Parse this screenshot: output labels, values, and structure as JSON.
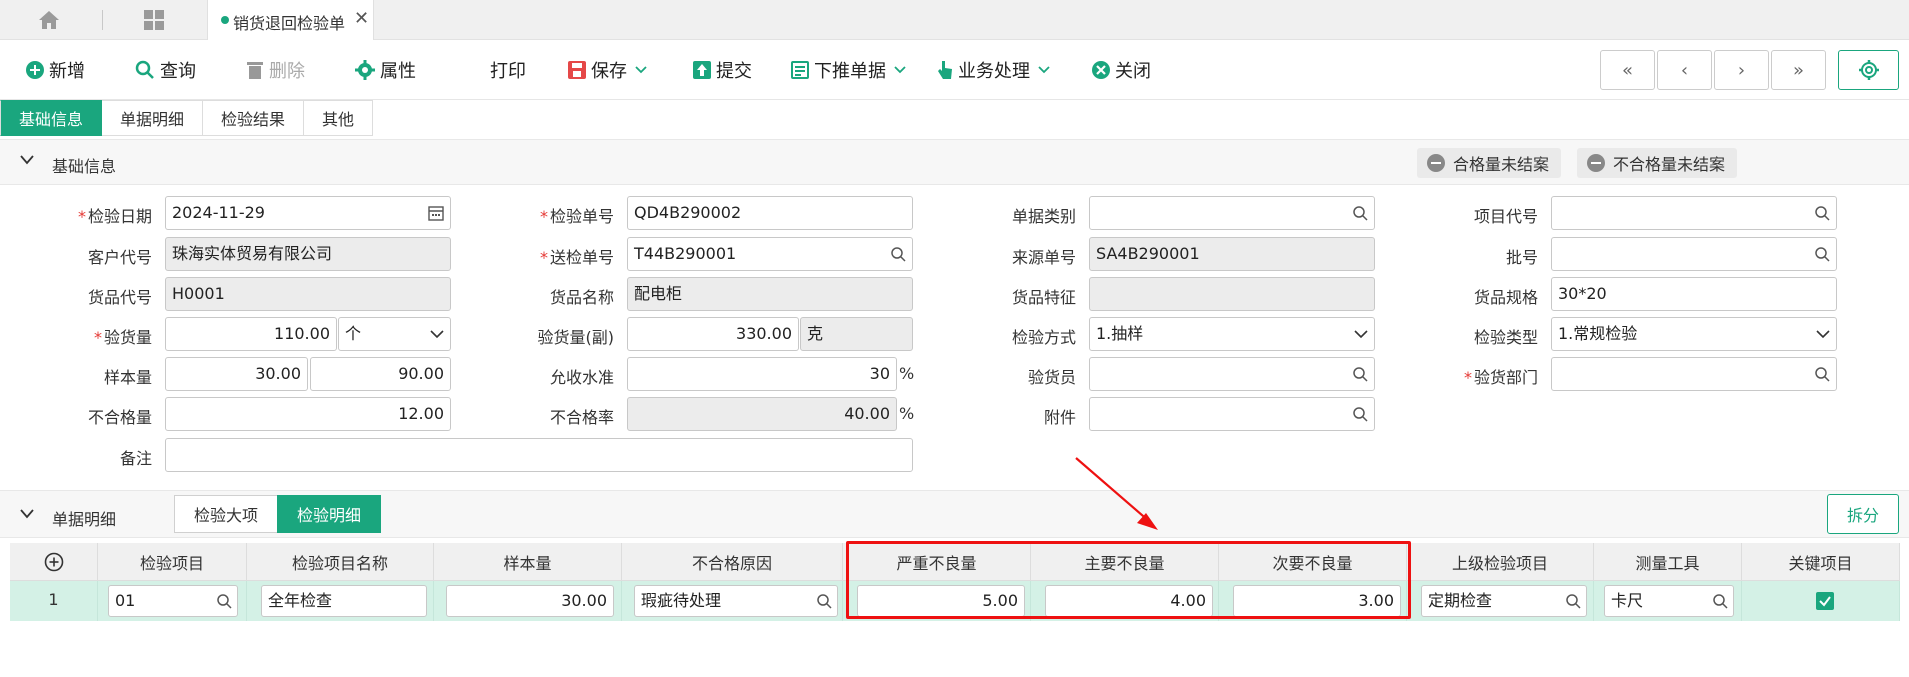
{
  "topbar": {
    "doc_tab_label": "销货退回检验单"
  },
  "toolbar": {
    "add": "新增",
    "query": "查询",
    "delete": "删除",
    "properties": "属性",
    "print": "打印",
    "save": "保存",
    "submit": "提交",
    "push_down": "下推单据",
    "business": "业务处理",
    "close": "关闭"
  },
  "section_tabs": [
    "基础信息",
    "单据明细",
    "检验结果",
    "其他"
  ],
  "basic_group": {
    "title": "基础信息",
    "btn_pass_open": "合格量未结案",
    "btn_fail_open": "不合格量未结案"
  },
  "form": {
    "inspect_date": {
      "label": "检验日期",
      "value": "2024-11-29"
    },
    "inspect_no": {
      "label": "检验单号",
      "value": "QD4B290002"
    },
    "doc_type": {
      "label": "单据类别",
      "value": ""
    },
    "project_code": {
      "label": "项目代号",
      "value": ""
    },
    "customer_code": {
      "label": "客户代号",
      "value": "珠海实体贸易有限公司"
    },
    "send_no": {
      "label": "送检单号",
      "value": "T44B290001"
    },
    "source_no": {
      "label": "来源单号",
      "value": "SA4B290001"
    },
    "batch_no": {
      "label": "批号",
      "value": ""
    },
    "goods_code": {
      "label": "货品代号",
      "value": "H0001"
    },
    "goods_name": {
      "label": "货品名称",
      "value": "配电柜"
    },
    "goods_feature": {
      "label": "货品特征",
      "value": ""
    },
    "goods_spec": {
      "label": "货品规格",
      "value": "30*20"
    },
    "inspect_qty": {
      "label": "验货量",
      "value": "110.00",
      "unit": "个"
    },
    "inspect_qty_sub": {
      "label": "验货量(副)",
      "value": "330.00",
      "unit": "克"
    },
    "inspect_method": {
      "label": "检验方式",
      "value": "1.抽样"
    },
    "inspect_type": {
      "label": "检验类型",
      "value": "1.常规检验"
    },
    "sample_qty": {
      "label": "样本量",
      "value1": "30.00",
      "value2": "90.00"
    },
    "accept_level": {
      "label": "允收水准",
      "value": "30",
      "unit": "%"
    },
    "inspector": {
      "label": "验货员",
      "value": ""
    },
    "inspect_dept": {
      "label": "验货部门",
      "value": ""
    },
    "fail_qty": {
      "label": "不合格量",
      "value": "12.00"
    },
    "fail_rate": {
      "label": "不合格率",
      "value": "40.00",
      "unit": "%"
    },
    "attachment": {
      "label": "附件",
      "value": ""
    },
    "remark": {
      "label": "备注",
      "value": ""
    }
  },
  "detail_group": {
    "title": "单据明细",
    "subtab_major": "检验大项",
    "subtab_detail": "检验明细",
    "split_btn": "拆分"
  },
  "grid": {
    "headers": [
      "检验项目",
      "检验项目名称",
      "样本量",
      "不合格原因",
      "严重不良量",
      "主要不良量",
      "次要不良量",
      "上级检验项目",
      "测量工具",
      "关键项目"
    ],
    "rows": [
      {
        "no": "1",
        "item": "01",
        "item_name": "全年检查",
        "sample": "30.00",
        "reason": "瑕疵待处理",
        "critical": "5.00",
        "major": "4.00",
        "minor": "3.00",
        "parent": "定期检查",
        "tool": "卡尺",
        "key": true
      }
    ]
  },
  "colors": {
    "accent": "#1aa67e",
    "highlight": "#e11111",
    "row_selected": "#d4f1e6"
  }
}
